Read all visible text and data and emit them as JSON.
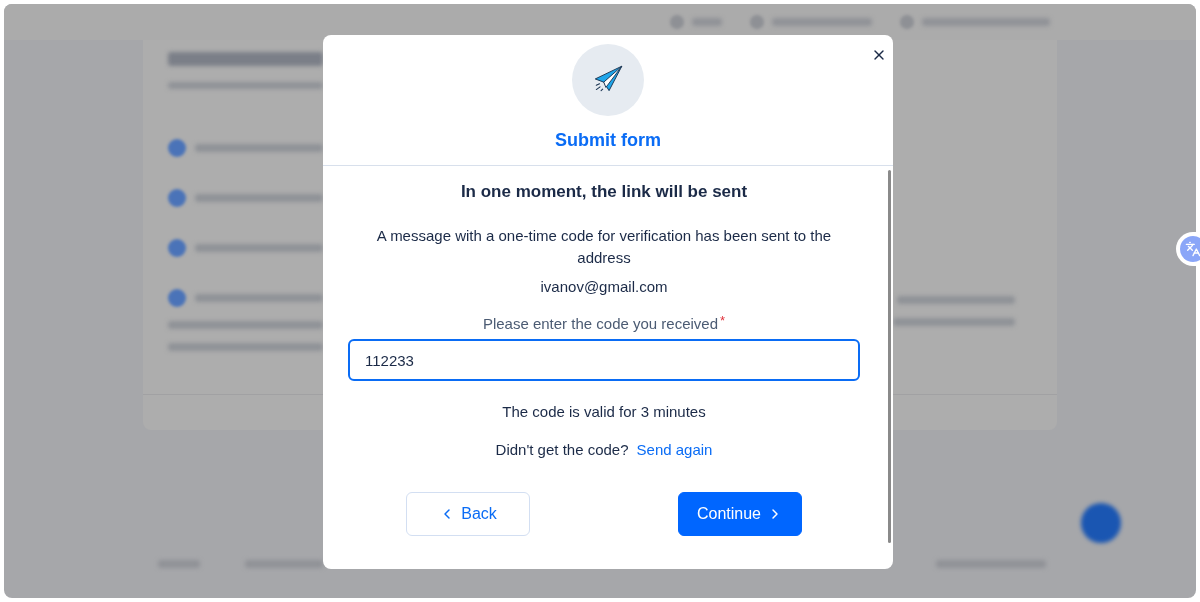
{
  "dialog": {
    "title": "Submit form",
    "heading": "In one moment, the link will be sent",
    "message": "A message with a one-time code for verification has been sent to the address",
    "email": "ivanov@gmail.com",
    "code_field": {
      "label": "Please enter the code you received",
      "required_mark": "*",
      "value": "112233",
      "focused": true
    },
    "validity_note": "The code is valid for 3 minutes",
    "resend": {
      "prompt": "Didn't get the code?",
      "link": "Send again"
    },
    "buttons": [
      {
        "label": "Back",
        "kind": "back"
      },
      {
        "label": "Continue",
        "kind": "next"
      }
    ]
  }
}
